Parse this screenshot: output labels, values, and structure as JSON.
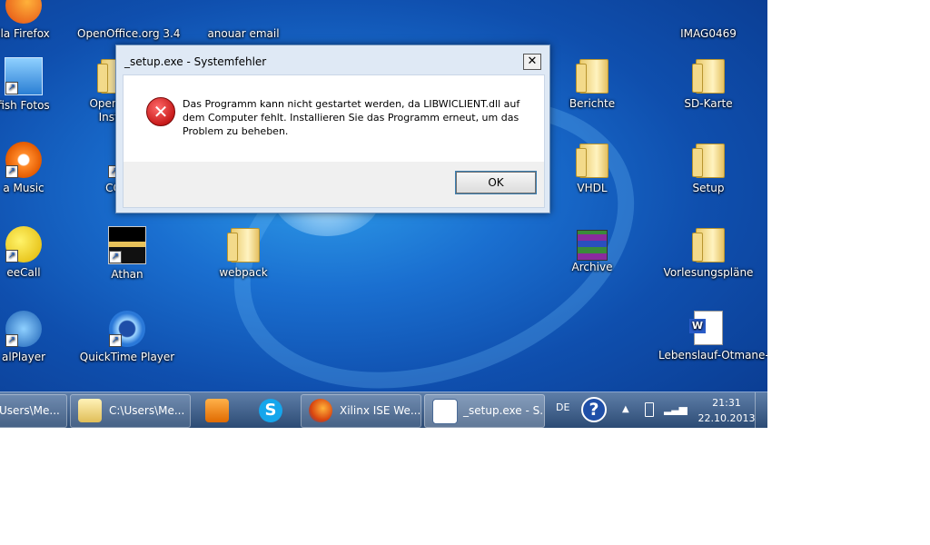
{
  "desktop": {
    "icons": {
      "firefox": "lla Firefox",
      "openoffice": "OpenOffice.org 3.4",
      "email": "anouar email",
      "imag": "IMAG0469",
      "fotos": "fish Fotos",
      "openoffice_install_1": "OpenOffi",
      "openoffice_install_2": "Instal",
      "berichte": "Berichte",
      "sdkarte": "SD-Karte",
      "music": "a Music",
      "co": "CO",
      "vhdl": "VHDL",
      "setup": "Setup",
      "freecall": "eeCall",
      "athan": "Athan",
      "webpack": "webpack",
      "archive": "Archive",
      "vorlesung": "Vorlesungspläne",
      "realplayer": "alPlayer",
      "quicktime": "QuickTime Player",
      "lebenslauf": "Lebenslauf-Otmane-..."
    }
  },
  "dialog": {
    "title": "_setup.exe - Systemfehler",
    "close": "✕",
    "message": "Das Programm kann nicht gestartet werden, da LIBWICLIENT.dll auf dem Computer fehlt. Installieren Sie das Programm erneut, um das Problem zu beheben.",
    "ok_label": "OK",
    "error_glyph": "✕"
  },
  "taskbar": {
    "items": [
      {
        "label": "Users\\Me..."
      },
      {
        "label": "C:\\Users\\Me..."
      },
      {
        "label": "Xilinx ISE We..."
      },
      {
        "label": "_setup.exe - S..."
      }
    ],
    "tray": {
      "lang": "DE",
      "help": "?",
      "time": "21:31",
      "date": "22.10.2013"
    }
  }
}
